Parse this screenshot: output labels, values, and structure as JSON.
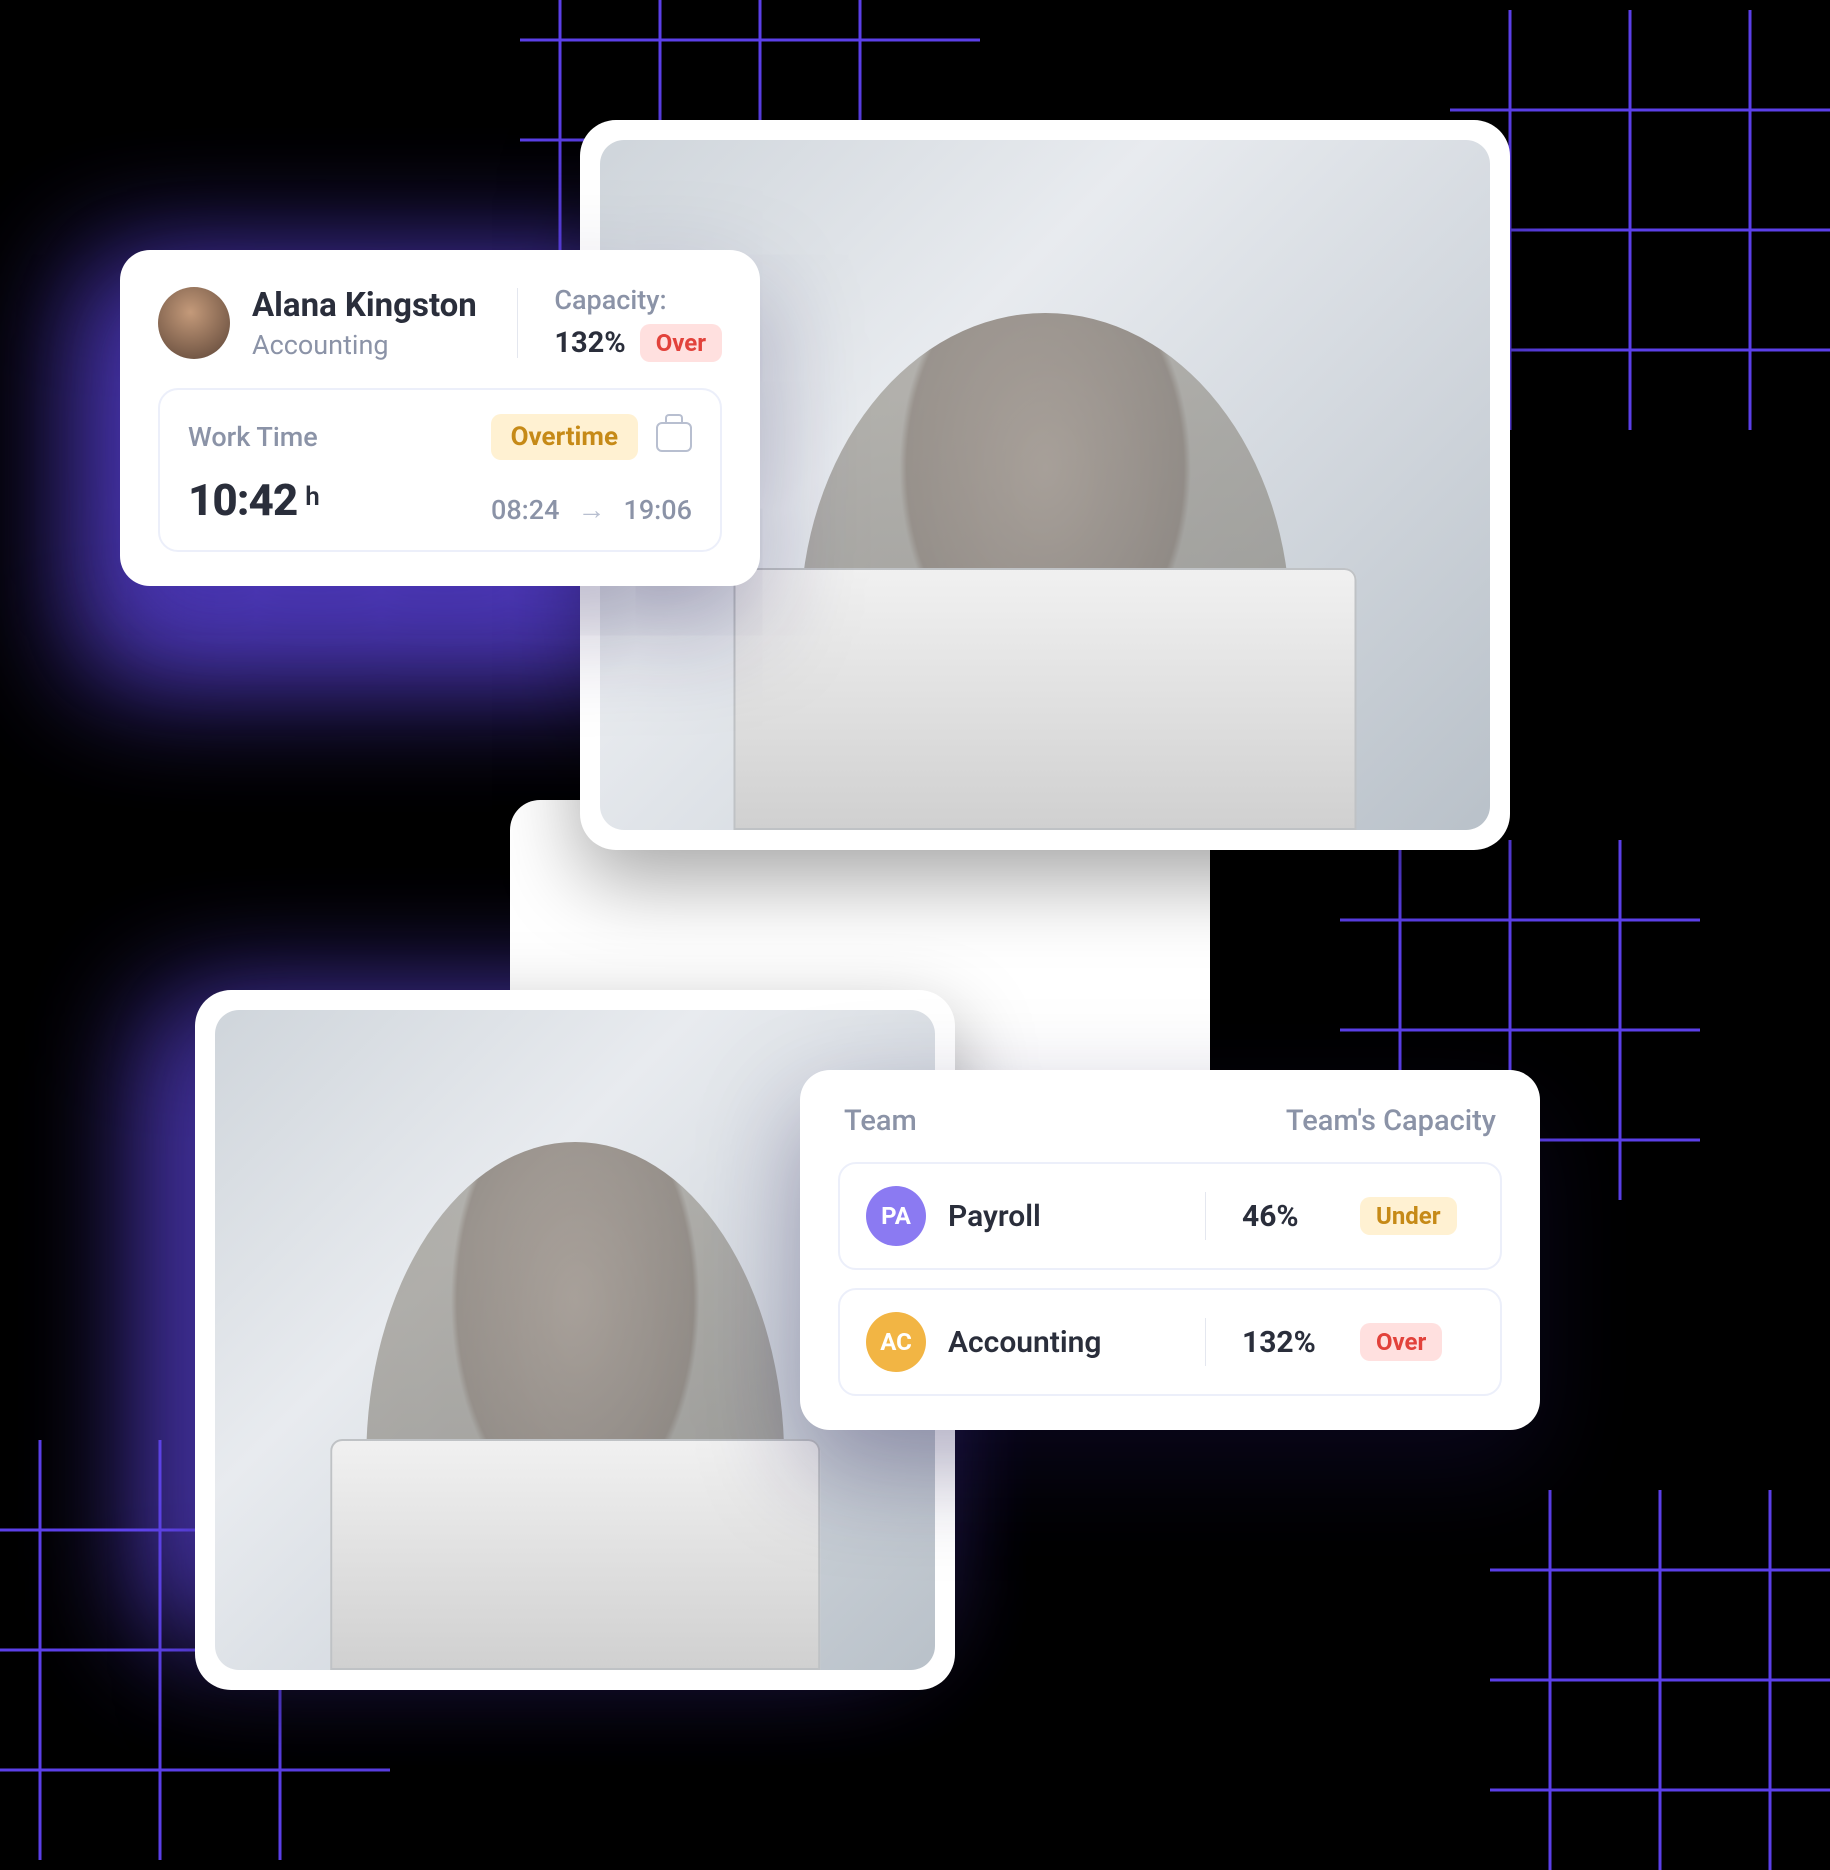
{
  "employee_card": {
    "name": "Alana Kingston",
    "department": "Accounting",
    "capacity_label": "Capacity:",
    "capacity_pct": "132%",
    "capacity_status": "Over",
    "work_time_label": "Work Time",
    "overtime_badge": "Overtime",
    "duration_value": "10:42",
    "duration_unit": "h",
    "start_time": "08:24",
    "end_time": "19:06"
  },
  "team_card": {
    "header_team": "Team",
    "header_capacity": "Team's Capacity",
    "rows": [
      {
        "abbr": "PA",
        "name": "Payroll",
        "pct": "46%",
        "status": "Under",
        "color": "purple"
      },
      {
        "abbr": "AC",
        "name": "Accounting",
        "pct": "132%",
        "status": "Over",
        "color": "amber"
      }
    ]
  }
}
